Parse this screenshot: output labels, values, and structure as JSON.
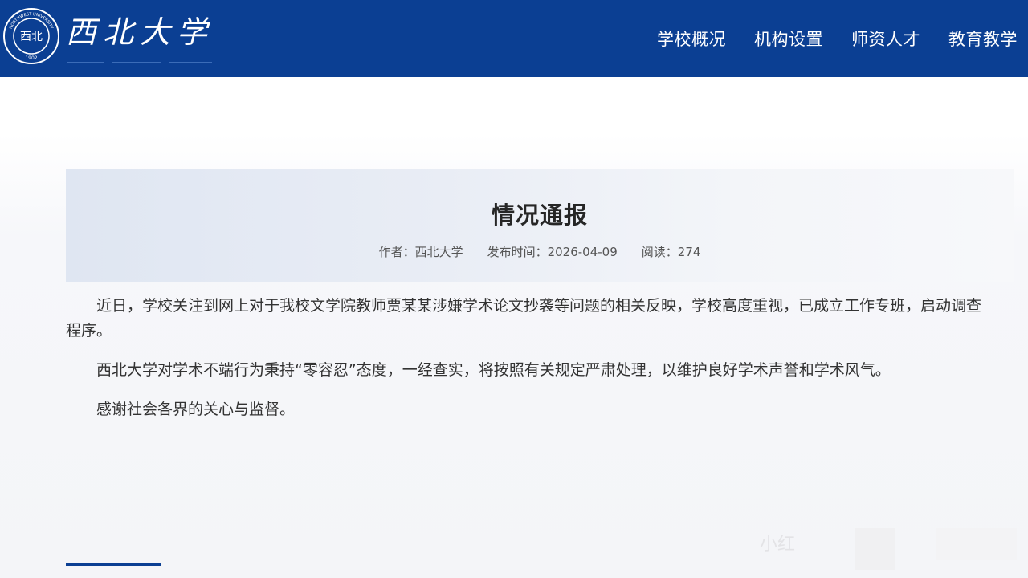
{
  "header": {
    "logo": {
      "name": "西北大学",
      "seal_text": "NORTHWEST UNIVERSITY",
      "seal_year": "1902",
      "seal_center": "西北"
    },
    "nav": [
      {
        "label": "学校概况"
      },
      {
        "label": "机构设置"
      },
      {
        "label": "师资人才"
      },
      {
        "label": "教育教学"
      }
    ],
    "bg_color": "#0b3f93"
  },
  "article": {
    "title": "情况通报",
    "meta": {
      "author": "作者：西北大学",
      "date": "发布时间：2026-04-09",
      "reads": "阅读：274"
    },
    "paragraphs": [
      "近日，学校关注到网上对于我校文学院教师贾某某涉嫌学术论文抄袭等问题的相关反映，学校高度重视，已成立工作专班，启动调查程序。",
      "西北大学对学术不端行为秉持“零容忍”态度，一经查实，将按照有关规定严肃处理，以维护良好学术声誉和学术风气。",
      "感谢社会各界的关心与监督。"
    ]
  },
  "watermark": {
    "text": "小红"
  }
}
